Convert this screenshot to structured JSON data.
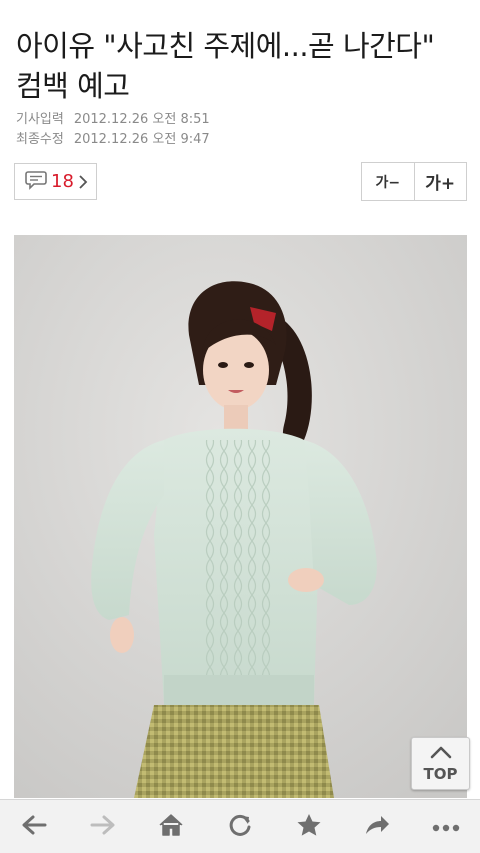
{
  "article": {
    "headline": "아이유 \"사고친 주제에...곧 나간다\" 컴백 예고",
    "published_label": "기사입력",
    "published_value": "2012.12.26 오전 8:51",
    "modified_label": "최종수정",
    "modified_value": "2012.12.26 오전 9:47"
  },
  "comments": {
    "count": "18"
  },
  "font_controls": {
    "decrease_label": "가−",
    "increase_label": "가+"
  },
  "photo": {
    "alt": ""
  },
  "top_button": {
    "label": "TOP"
  },
  "bottom_nav": {
    "icons": [
      "back-arrow-icon",
      "forward-arrow-icon",
      "home-icon",
      "refresh-icon",
      "bookmark-star-icon",
      "share-icon",
      "more-icon"
    ]
  },
  "colors": {
    "comment_count": "#d81b2b",
    "meta_text": "#8a8a8a",
    "toolbar_bg": "#f2f2f2",
    "icon_gray": "#6f6f6f"
  }
}
